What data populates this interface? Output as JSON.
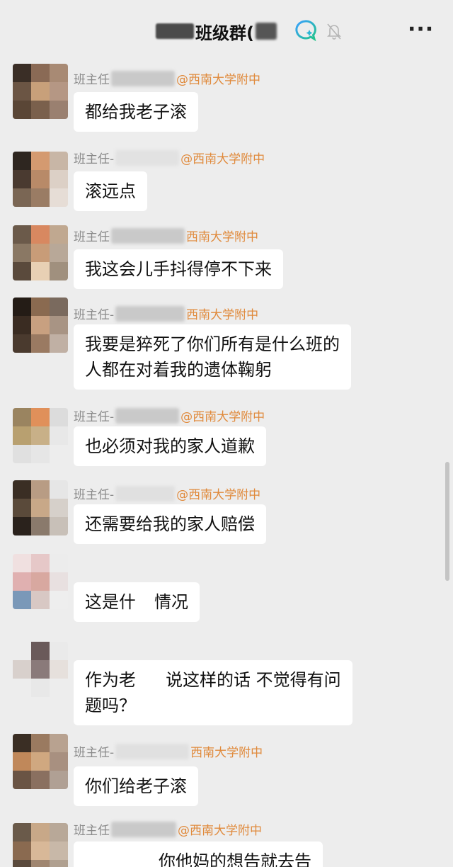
{
  "header": {
    "title": "班级群(",
    "ai_icon": "ai-assistant-icon",
    "mute_icon": "bell-muted-icon",
    "more_label": "···"
  },
  "messages": [
    {
      "sender_prefix": "班主任",
      "school": "@西南大学附中",
      "text": "都给我老子滚"
    },
    {
      "sender_prefix": "班主任-",
      "school": "@西南大学附中",
      "text": "滚远点"
    },
    {
      "sender_prefix": "班主任",
      "school": "西南大学附中",
      "text": "我这会儿手抖得停不下来"
    },
    {
      "sender_prefix": "班主任-",
      "school": "西南大学附中",
      "text_line1": "我要是猝死了你们所有是什么班的",
      "text_line2": "人都在对着我的遗体鞠躬"
    },
    {
      "sender_prefix": "班主任-",
      "school": "@西南大学附中",
      "text": "也必须对我的家人道歉"
    },
    {
      "sender_prefix": "班主任-",
      "school": "@西南大学附中",
      "text": "还需要给我的家人赔偿"
    },
    {
      "text_a": "这是什",
      "text_b": "情况"
    },
    {
      "text_a": "作为老",
      "text_b": "说这样的话 不觉得有问",
      "text_line2": "题吗？"
    },
    {
      "sender_prefix": "班主任-",
      "school": "西南大学附中",
      "text": "你们给老子滚"
    },
    {
      "sender_prefix": "班主任",
      "school": "@西南大学附中",
      "text": "你他妈的想告就去告"
    }
  ]
}
